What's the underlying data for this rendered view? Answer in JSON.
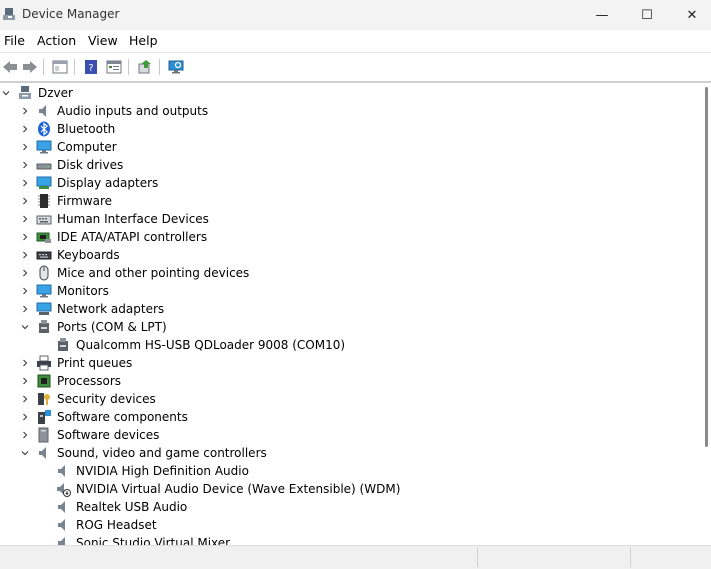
{
  "window": {
    "title": "Device Manager",
    "minimize_glyph": "—",
    "maximize_glyph": "☐",
    "close_glyph": "✕"
  },
  "menu": {
    "file": "File",
    "action": "Action",
    "view": "View",
    "help": "Help"
  },
  "toolbar": {
    "buttons": [
      "back-icon",
      "forward-icon",
      "show-hide-console-tree-icon",
      "help-icon",
      "properties-icon",
      "update-driver-icon",
      "scan-hardware-icon"
    ]
  },
  "tree": {
    "root": "Dzver",
    "categories": {
      "audio": "Audio inputs and outputs",
      "bluetooth": "Bluetooth",
      "computer": "Computer",
      "disk": "Disk drives",
      "display": "Display adapters",
      "firmware": "Firmware",
      "hid": "Human Interface Devices",
      "ide": "IDE ATA/ATAPI controllers",
      "keyboards": "Keyboards",
      "mice": "Mice and other pointing devices",
      "monitors": "Monitors",
      "network": "Network adapters",
      "ports": "Ports (COM & LPT)",
      "print": "Print queues",
      "processors": "Processors",
      "security": "Security devices",
      "swcomponents": "Software components",
      "swdevices": "Software devices",
      "sound": "Sound, video and game controllers"
    },
    "ports_children": {
      "qualcomm": "Qualcomm HS-USB QDLoader 9008 (COM10)"
    },
    "sound_children": {
      "nvidia_hda": "NVIDIA High Definition Audio",
      "nvidia_virtual": "NVIDIA Virtual Audio Device (Wave Extensible) (WDM)",
      "realtek": "Realtek USB Audio",
      "rog": "ROG Headset",
      "sonic": "Sonic Studio Virtual Mixer"
    }
  }
}
